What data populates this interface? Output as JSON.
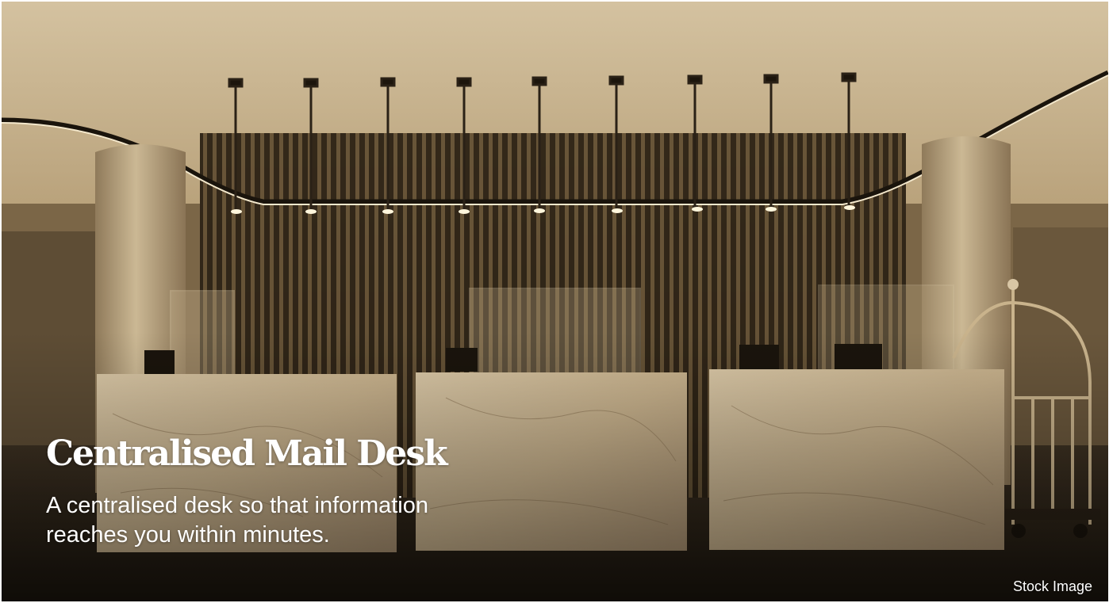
{
  "hero": {
    "title": "Centralised Mail Desk",
    "description": "A centralised desk so that information reaches you within minutes.",
    "image_note": "Stock Image"
  },
  "colors": {
    "sepia_light": "#d9c8a6",
    "sepia_mid": "#9b8461",
    "sepia_dark": "#3a2e1e",
    "text": "#ffffff"
  }
}
